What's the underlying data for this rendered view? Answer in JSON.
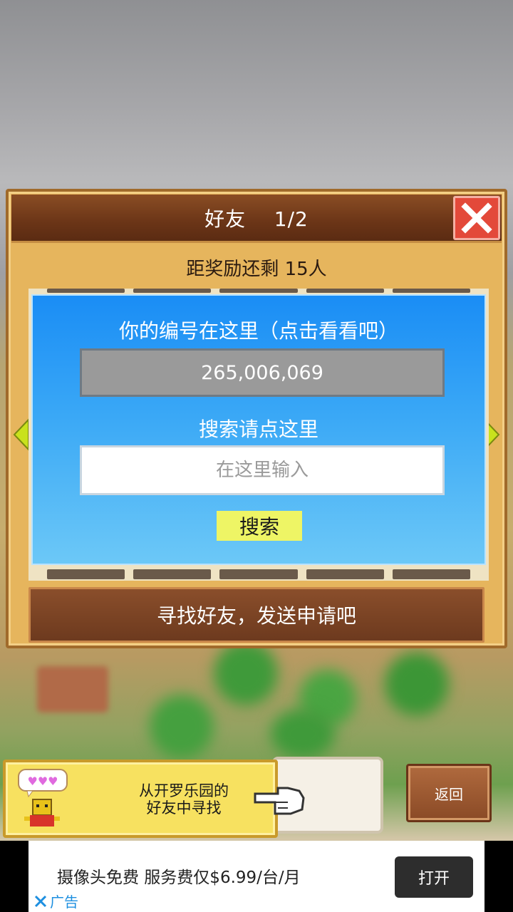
{
  "dialog": {
    "title": "好友",
    "page": "1/2",
    "reward_text": "距奖励还剩 15人",
    "close_icon": "close-x-icon"
  },
  "panel": {
    "id_label": "你的编号在这里（点击看看吧）",
    "id_value": "265,006,069",
    "search_label": "搜索请点这里",
    "search_placeholder": "在这里输入",
    "search_button": "搜索"
  },
  "send_button": "寻找好友，发送申请吧",
  "banner": {
    "text_line1": "从开罗乐园的",
    "text_line2": "好友中寻找"
  },
  "back_button": "返回",
  "ad": {
    "text": "摄像头免费 服务费仅$6.99/台/月",
    "open_button": "打开",
    "tag": "广告"
  },
  "colors": {
    "accent_blue": "#1a8df5",
    "title_brown": "#6b3517",
    "close_red": "#e3493a",
    "search_yellow": "#eef565"
  }
}
